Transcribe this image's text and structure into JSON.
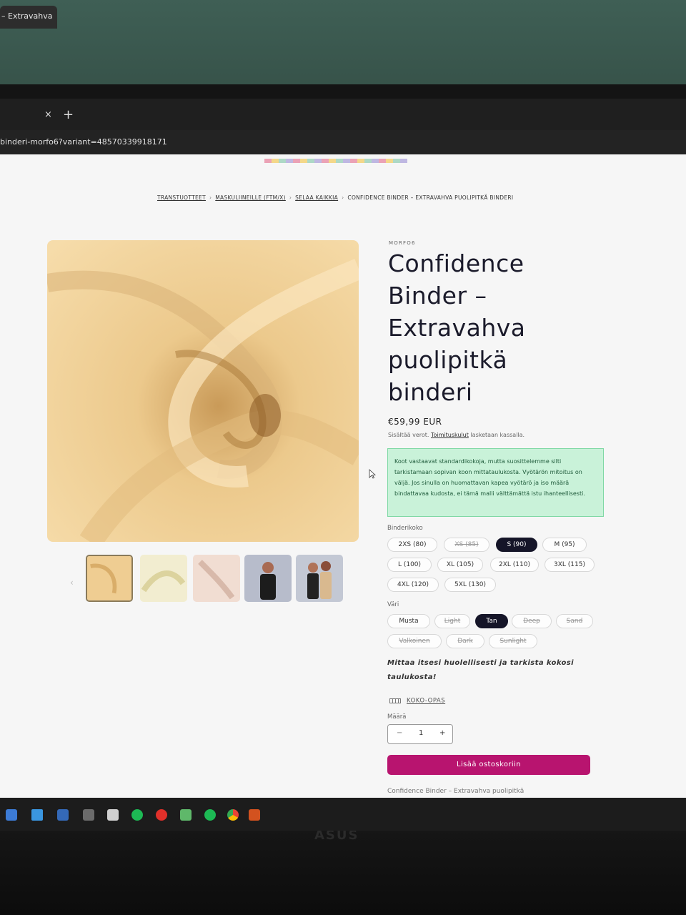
{
  "browser": {
    "tab_title": "– Extravahva",
    "tab_close": "×",
    "tab_new": "+",
    "url": "binderi-morfo6?variant=48570339918171"
  },
  "breadcrumb": {
    "items": [
      "TRANSTUOTTEET",
      "MASKULIINEILLE (FTM/X)",
      "SELAA KAIKKIA",
      "CONFIDENCE BINDER – EXTRAVAHVA PUOLIPITKÄ BINDERI"
    ],
    "separator": "›"
  },
  "product": {
    "vendor": "MORFO6",
    "title_lines": [
      "Confidence",
      "Binder –",
      "Extravahva",
      "puolipitkä",
      "binderi"
    ],
    "price": "€59,99 EUR",
    "tax_prefix": "Sisältää verot.",
    "shipping_link": "Toimituskulut",
    "tax_suffix": "lasketaan kassalla.",
    "notice": "Koot vastaavat standardikokoja, mutta suosittelemme silti tarkistamaan sopivan koon mittataulukosta. Vyötärön mitoitus on väljä. Jos sinulla on huomattavan kapea vyötärö ja iso määrä bindattavaa kudosta, ei tämä malli välttämättä istu ihanteellisesti.",
    "size_label": "Binderikoko",
    "sizes": [
      {
        "label": "2XS (80)",
        "state": "available"
      },
      {
        "label": "XS (85)",
        "state": "disabled"
      },
      {
        "label": "S (90)",
        "state": "selected"
      },
      {
        "label": "M (95)",
        "state": "available"
      },
      {
        "label": "L (100)",
        "state": "available"
      },
      {
        "label": "XL (105)",
        "state": "available"
      },
      {
        "label": "2XL (110)",
        "state": "available"
      },
      {
        "label": "3XL (115)",
        "state": "available"
      },
      {
        "label": "4XL (120)",
        "state": "available"
      },
      {
        "label": "5XL (130)",
        "state": "available"
      }
    ],
    "color_label": "Väri",
    "colors": [
      {
        "label": "Musta",
        "state": "available"
      },
      {
        "label": "Light",
        "state": "disabled"
      },
      {
        "label": "Tan",
        "state": "selected"
      },
      {
        "label": "Deep",
        "state": "disabled"
      },
      {
        "label": "Sand",
        "state": "disabled"
      },
      {
        "label": "Valkoinen",
        "state": "disabled"
      },
      {
        "label": "Dark",
        "state": "disabled"
      },
      {
        "label": "Sunlight",
        "state": "disabled"
      }
    ],
    "measure_note": "Mittaa itsesi huolellisesti ja tarkista kokosi taulukosta!",
    "size_guide": "KOKO-OPAS",
    "quantity_label": "Määrä",
    "quantity": {
      "minus": "−",
      "value": "1",
      "plus": "+"
    },
    "add_to_cart": "Lisää ostoskoriin",
    "description_peek": "Confidence Binder – Extravahva puolipitkä"
  },
  "colors": {
    "accent": "#b8146f",
    "selected_chip": "#151528",
    "notice_bg": "#c9f2d9",
    "fabric": "#f0cf94"
  },
  "taskbar": {
    "icons": [
      "windows-icon",
      "check-icon",
      "square-icon",
      "minecraft-icon",
      "file-icon",
      "spotify-icon",
      "opera-icon",
      "recycle-icon",
      "spotify-icon",
      "chrome-icon",
      "app-icon"
    ]
  },
  "monitor_brand": "ASUS"
}
